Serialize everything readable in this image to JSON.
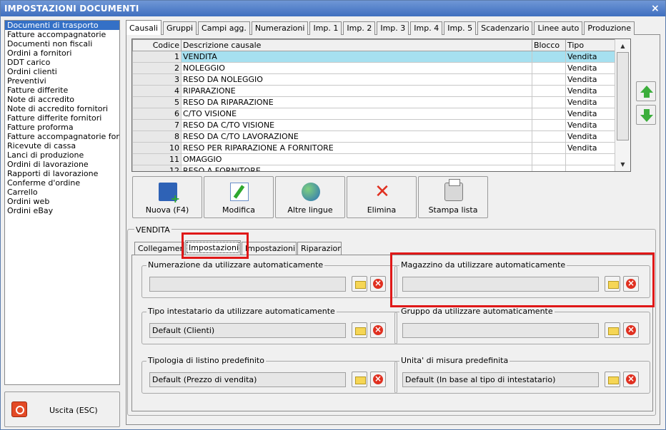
{
  "window": {
    "title": "IMPOSTAZIONI DOCUMENTI",
    "close_glyph": "×"
  },
  "colors": {
    "highlight": "#e01818",
    "selection": "#3470c6",
    "row_selected": "#a6e0f0"
  },
  "sidebar": {
    "items": [
      {
        "label": "Documenti di trasporto",
        "selected": true
      },
      {
        "label": "Fatture accompagnatorie"
      },
      {
        "label": "Documenti non fiscali"
      },
      {
        "label": "Ordini a fornitori"
      },
      {
        "label": "DDT carico"
      },
      {
        "label": "Ordini clienti"
      },
      {
        "label": "Preventivi"
      },
      {
        "label": "Fatture differite"
      },
      {
        "label": "Note di accredito"
      },
      {
        "label": "Note di accredito fornitori"
      },
      {
        "label": "Fatture differite fornitori"
      },
      {
        "label": "Fatture proforma"
      },
      {
        "label": "Fatture accompagnatorie fornito"
      },
      {
        "label": "Ricevute di cassa"
      },
      {
        "label": "Lanci di produzione"
      },
      {
        "label": "Ordini di lavorazione"
      },
      {
        "label": "Rapporti di lavorazione"
      },
      {
        "label": "Conferme d'ordine"
      },
      {
        "label": "Carrello"
      },
      {
        "label": "Ordini web"
      },
      {
        "label": "Ordini eBay"
      }
    ],
    "exit_label": "Uscita (ESC)",
    "exit_icon": "power-icon"
  },
  "tabs": [
    "Causali",
    "Gruppi",
    "Campi agg.",
    "Numerazioni",
    "Imp. 1",
    "Imp. 2",
    "Imp. 3",
    "Imp. 4",
    "Imp. 5",
    "Scadenzario",
    "Linee auto",
    "Produzione"
  ],
  "grid": {
    "headers": [
      "Codice",
      "Descrizione causale",
      "Blocco",
      "Tipo"
    ],
    "rows": [
      {
        "code": "1",
        "desc": "VENDITA",
        "blocco": "",
        "tipo": "Vendita",
        "selected": true
      },
      {
        "code": "2",
        "desc": "NOLEGGIO",
        "blocco": "",
        "tipo": "Vendita"
      },
      {
        "code": "3",
        "desc": "RESO DA NOLEGGIO",
        "blocco": "",
        "tipo": "Vendita"
      },
      {
        "code": "4",
        "desc": "RIPARAZIONE",
        "blocco": "",
        "tipo": "Vendita"
      },
      {
        "code": "5",
        "desc": "RESO DA RIPARAZIONE",
        "blocco": "",
        "tipo": "Vendita"
      },
      {
        "code": "6",
        "desc": "C/TO VISIONE",
        "blocco": "",
        "tipo": "Vendita"
      },
      {
        "code": "7",
        "desc": "RESO DA C/TO VISIONE",
        "blocco": "",
        "tipo": "Vendita"
      },
      {
        "code": "8",
        "desc": "RESO DA C/TO LAVORAZIONE",
        "blocco": "",
        "tipo": "Vendita"
      },
      {
        "code": "10",
        "desc": "RESO PER RIPARAZIONE A FORNITORE",
        "blocco": "",
        "tipo": "Vendita"
      },
      {
        "code": "11",
        "desc": "OMAGGIO",
        "blocco": "",
        "tipo": ""
      },
      {
        "code": "12",
        "desc": "RESO A FORNITORE",
        "blocco": "",
        "tipo": ""
      }
    ]
  },
  "toolbar": [
    {
      "label": "Nuova (F4)",
      "icon": "new-document-icon"
    },
    {
      "label": "Modifica",
      "icon": "edit-icon"
    },
    {
      "label": "Altre lingue",
      "icon": "globe-icon"
    },
    {
      "label": "Elimina",
      "icon": "delete-icon"
    },
    {
      "label": "Stampa lista",
      "icon": "printer-icon"
    }
  ],
  "section": {
    "title": "VENDITA",
    "subtabs": [
      "Collegamenti",
      "Impostazioni",
      "Impostazioni 2",
      "Riparazioni"
    ],
    "groups": [
      {
        "title": "Numerazione da utilizzare automaticamente",
        "value": ""
      },
      {
        "title": "Magazzino da utilizzare automaticamente",
        "value": ""
      },
      {
        "title": "Tipo intestatario da utilizzare automaticamente",
        "value": "Default (Clienti)"
      },
      {
        "title": "Gruppo da utilizzare automaticamente",
        "value": ""
      },
      {
        "title": "Tipologia di listino predefinito",
        "value": "Default (Prezzo di vendita)"
      },
      {
        "title": "Unita' di misura predefinita",
        "value": "Default (In base al tipo di intestatario)"
      }
    ]
  }
}
